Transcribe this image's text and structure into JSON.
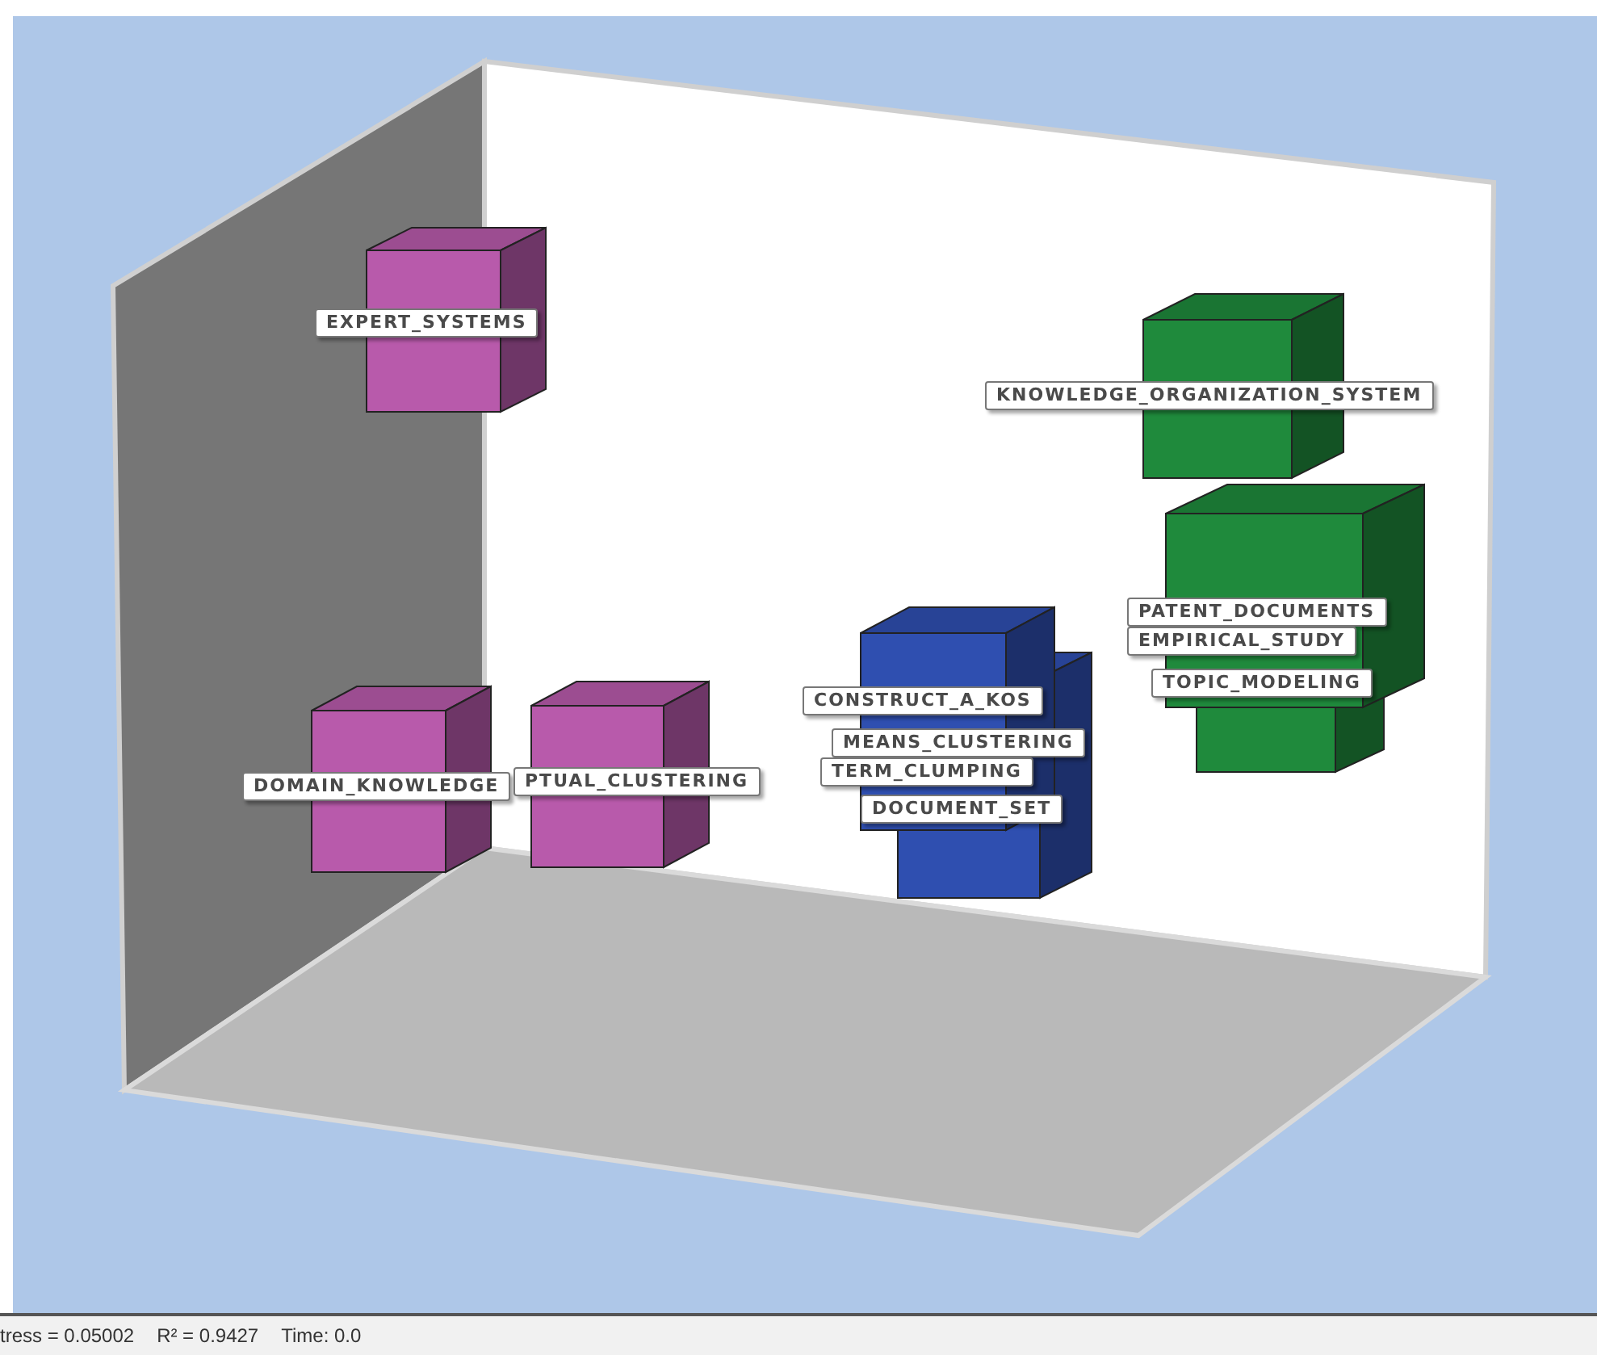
{
  "plot": {
    "cubes": [
      {
        "color": "#b85aab"
      },
      {
        "color": "#b85aab"
      },
      {
        "color": "#b85aab"
      },
      {
        "color": "#2f4fb0"
      },
      {
        "color": "#2f4fb0"
      },
      {
        "color": "#1f8a3c"
      },
      {
        "color": "#1f8a3c"
      },
      {
        "color": "#1f8a3c"
      }
    ],
    "labels": [
      "EXPERT_SYSTEMS",
      "KNOWLEDGE_ORGANIZATION_SYSTEM",
      "PATENT_DOCUMENTS",
      "EMPIRICAL_STUDY",
      "TOPIC_MODELING",
      "CONSTRUCT_A_KOS",
      "MEANS_CLUSTERING",
      "TERM_CLUMPING",
      "DOMAIN_KNOWLEDGE",
      "PTUAL_CLUSTERING",
      "DOCUMENT_SET"
    ]
  },
  "status_bar": {
    "stress": "tress = 0.05002",
    "r_squared": "R² = 0.9427",
    "time": "Time: 0.0"
  }
}
